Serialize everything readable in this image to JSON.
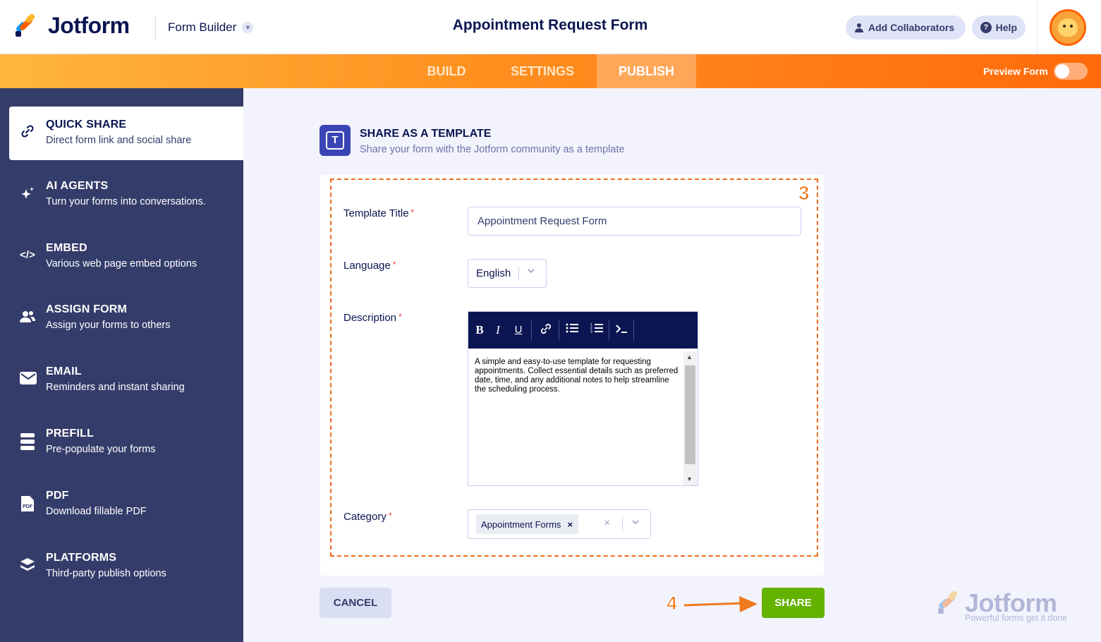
{
  "app": {
    "logo_text": "Jotform",
    "builder_label": "Form Builder",
    "form_title": "Appointment Request Form",
    "add_collaborators": "Add Collaborators",
    "help": "Help"
  },
  "nav": {
    "tabs": [
      {
        "label": "BUILD",
        "active": false
      },
      {
        "label": "SETTINGS",
        "active": false
      },
      {
        "label": "PUBLISH",
        "active": true
      }
    ],
    "preview_label": "Preview Form",
    "preview_on": false
  },
  "sidebar": {
    "items": [
      {
        "title": "QUICK SHARE",
        "subtitle": "Direct form link and social share",
        "icon": "link-icon",
        "active": true
      },
      {
        "title": "AI AGENTS",
        "subtitle": "Turn your forms into conversations.",
        "icon": "sparkle-icon",
        "active": false
      },
      {
        "title": "EMBED",
        "subtitle": "Various web page embed options",
        "icon": "code-icon",
        "active": false
      },
      {
        "title": "ASSIGN FORM",
        "subtitle": "Assign your forms to others",
        "icon": "users-icon",
        "active": false
      },
      {
        "title": "EMAIL",
        "subtitle": "Reminders and instant sharing",
        "icon": "envelope-icon",
        "active": false
      },
      {
        "title": "PREFILL",
        "subtitle": "Pre-populate your forms",
        "icon": "prefill-icon",
        "active": false
      },
      {
        "title": "PDF",
        "subtitle": "Download fillable PDF",
        "icon": "pdf-icon",
        "active": false
      },
      {
        "title": "PLATFORMS",
        "subtitle": "Third-party publish options",
        "icon": "layers-icon",
        "active": false
      }
    ]
  },
  "section": {
    "title": "SHARE AS A TEMPLATE",
    "subtitle": "Share your form with the Jotform community as a template"
  },
  "form": {
    "step_marker": "3",
    "required_mark": "*",
    "template_title_label": "Template Title",
    "template_title_value": "Appointment Request Form",
    "language_label": "Language",
    "language_value": "English",
    "description_label": "Description",
    "description_value": "A simple and easy-to-use template for requesting appointments. Collect essential details such as preferred date, time, and any additional notes to help streamline the scheduling process.",
    "category_label": "Category",
    "category_value": "Appointment Forms",
    "toolbar": {
      "bold": "B",
      "italic": "I",
      "underline": "U"
    }
  },
  "actions": {
    "cancel": "CANCEL",
    "share": "SHARE",
    "step_marker": "4"
  },
  "watermark": {
    "text": "Jotform",
    "tagline": "Powerful forms get it done"
  },
  "colors": {
    "brand_navy": "#0a1551",
    "sidebar_bg": "#343c6a",
    "accent_orange": "#ff6100",
    "share_green": "#64b200",
    "annotation": "#f06a1d"
  }
}
